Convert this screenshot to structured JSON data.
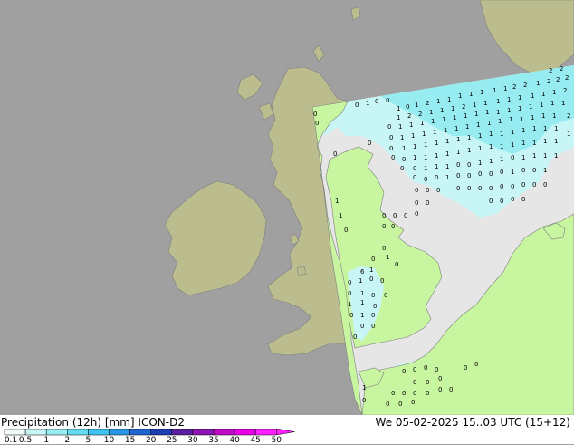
{
  "title": "Precipitation (12h) [mm] ICON-D2",
  "valid_time": "We 05-02-2025 15..03 UTC (15+12)",
  "colors": {
    "sea": "#e6e6e6",
    "land_outside": "#a0a0a0",
    "land_outside_fill": "#bcbd8f",
    "land_inside": "#c8f5a0",
    "border": "#7f7f7f"
  },
  "legend": {
    "labels": [
      "0.1",
      "0.5",
      "1",
      "2",
      "5",
      "10",
      "15",
      "20",
      "25",
      "30",
      "35",
      "40",
      "45",
      "50"
    ],
    "colors": [
      "#f0fcfc",
      "#c8f5f5",
      "#96ecf0",
      "#64dcf0",
      "#3cc3f0",
      "#2896e6",
      "#1e64d2",
      "#1e3cb4",
      "#5a1ea0",
      "#8c14b4",
      "#be0ac8",
      "#e600e6",
      "#ff1eff"
    ]
  }
}
